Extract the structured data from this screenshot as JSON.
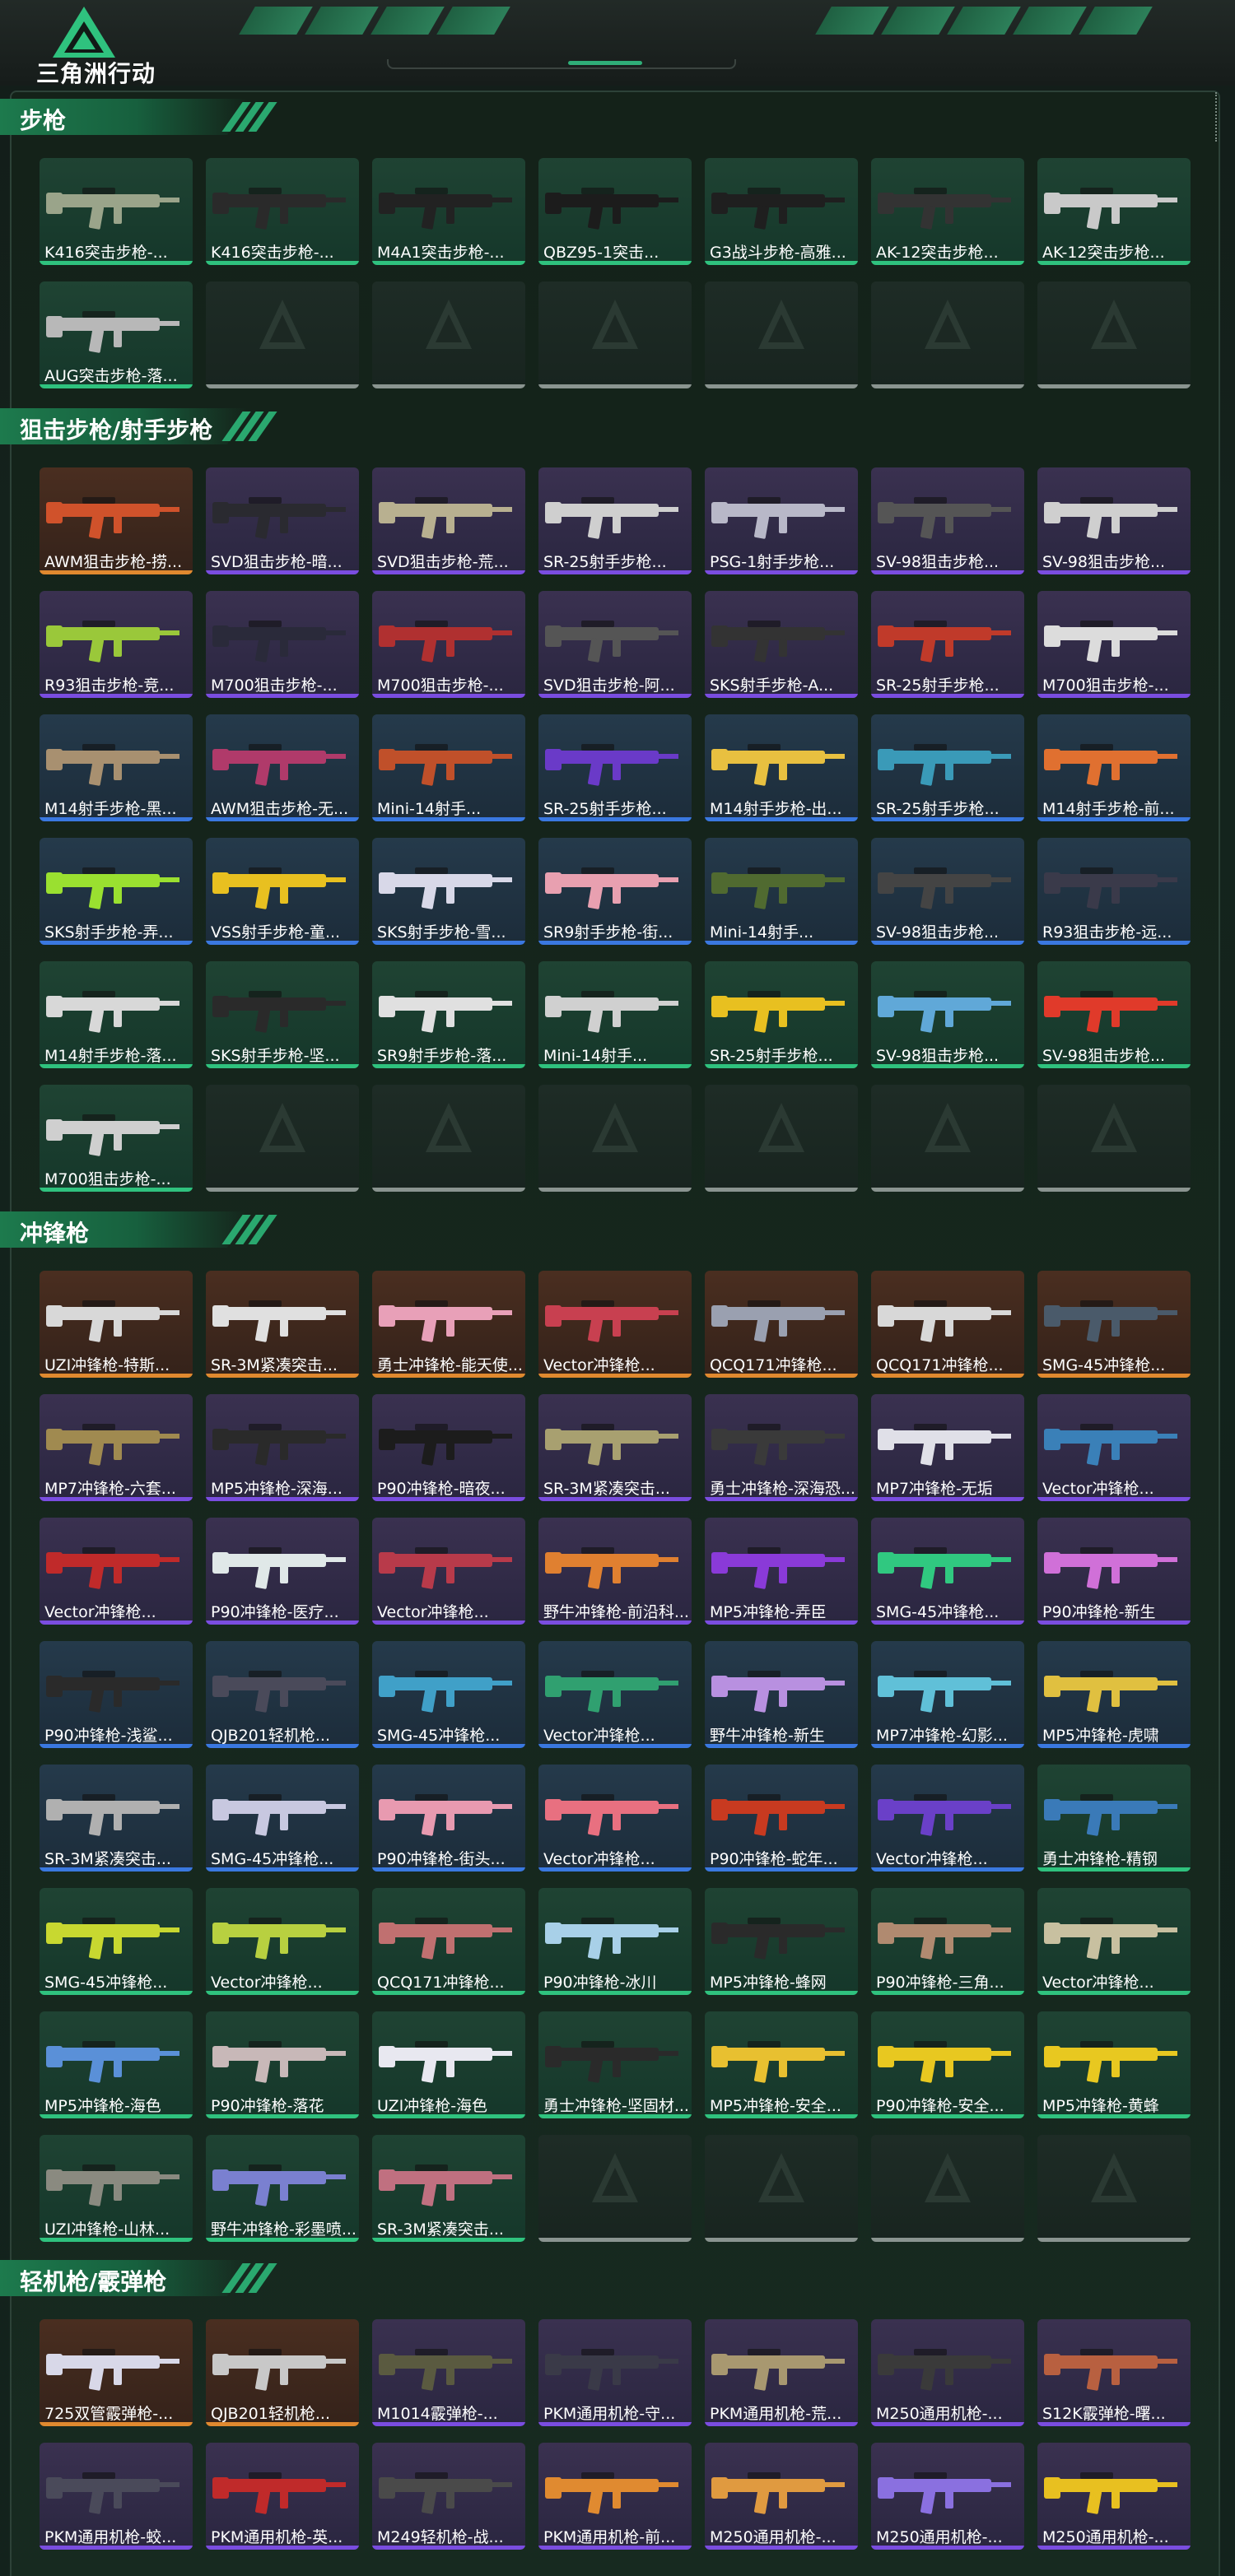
{
  "app": {
    "title": "三角洲行动"
  },
  "colors": {
    "purple": "#7a4de0",
    "green": "#2fc27e",
    "blue": "#3a78e0",
    "orange": "#e0892f",
    "empty": "#8a9490"
  },
  "sections": [
    {
      "title": "步枪",
      "rows": [
        [
          {
            "label": "K416突击步枪-...",
            "rarity": "green",
            "gun": "#9aa48a"
          },
          {
            "label": "K416突击步枪-...",
            "rarity": "green",
            "gun": "#2a2a2a"
          },
          {
            "label": "M4A1突击步枪-...",
            "rarity": "green",
            "gun": "#222"
          },
          {
            "label": "QBZ95-1突击...",
            "rarity": "green",
            "gun": "#1c1c1c"
          },
          {
            "label": "G3战斗步枪-高雅...",
            "rarity": "green",
            "gun": "#1f1f1f"
          },
          {
            "label": "AK-12突击步枪...",
            "rarity": "green",
            "gun": "#333"
          },
          {
            "label": "AK-12突击步枪...",
            "rarity": "green",
            "gun": "#c9c9c9"
          }
        ],
        [
          {
            "label": "AUG突击步枪-落...",
            "rarity": "green",
            "gun": "#b8b8b8"
          },
          {
            "empty": true
          },
          {
            "empty": true
          },
          {
            "empty": true
          },
          {
            "empty": true
          },
          {
            "empty": true
          },
          {
            "empty": true
          }
        ]
      ]
    },
    {
      "title": "狙击步枪/射手步枪",
      "rows": [
        [
          {
            "label": "AWM狙击步枪-捞...",
            "rarity": "orange",
            "gun": "#d0522b"
          },
          {
            "label": "SVD狙击步枪-暗...",
            "rarity": "purple",
            "gun": "#2a2a30"
          },
          {
            "label": "SVD狙击步枪-荒...",
            "rarity": "purple",
            "gun": "#b8b090"
          },
          {
            "label": "SR-25射手步枪...",
            "rarity": "purple",
            "gun": "#cfcfcf"
          },
          {
            "label": "PSG-1射手步枪...",
            "rarity": "purple",
            "gun": "#b8b8c8"
          },
          {
            "label": "SV-98狙击步枪...",
            "rarity": "purple",
            "gun": "#555"
          },
          {
            "label": "SV-98狙击步枪...",
            "rarity": "purple",
            "gun": "#cfcfcf"
          }
        ],
        [
          {
            "label": "R93狙击步枪-竞...",
            "rarity": "purple",
            "gun": "#9ac83a"
          },
          {
            "label": "M700狙击步枪-...",
            "rarity": "purple",
            "gun": "#2a2a3a"
          },
          {
            "label": "M700狙击步枪-...",
            "rarity": "purple",
            "gun": "#b03030"
          },
          {
            "label": "SVD狙击步枪-阿...",
            "rarity": "purple",
            "gun": "#555"
          },
          {
            "label": "SKS射手步枪-A...",
            "rarity": "purple",
            "gun": "#333"
          },
          {
            "label": "SR-25射手步枪...",
            "rarity": "purple",
            "gun": "#c03a2a"
          },
          {
            "label": "M700狙击步枪-...",
            "rarity": "purple",
            "gun": "#dcdcdc"
          }
        ],
        [
          {
            "label": "M14射手步枪-黑...",
            "rarity": "blue",
            "gun": "#a89070"
          },
          {
            "label": "AWM狙击步枪-无...",
            "rarity": "blue",
            "gun": "#b03a6a"
          },
          {
            "label": "Mini-14射手...",
            "rarity": "blue",
            "gun": "#c0502a"
          },
          {
            "label": "SR-25射手步枪...",
            "rarity": "blue",
            "gun": "#6a3ac8"
          },
          {
            "label": "M14射手步枪-出...",
            "rarity": "blue",
            "gun": "#e8c040"
          },
          {
            "label": "SR-25射手步枪...",
            "rarity": "blue",
            "gun": "#3a9ab8"
          },
          {
            "label": "M14射手步枪-前...",
            "rarity": "blue",
            "gun": "#e07030"
          }
        ],
        [
          {
            "label": "SKS射手步枪-弄...",
            "rarity": "blue",
            "gun": "#9ae030"
          },
          {
            "label": "VSS射手步枪-童...",
            "rarity": "blue",
            "gun": "#e8c020"
          },
          {
            "label": "SKS射手步枪-雪...",
            "rarity": "blue",
            "gun": "#d8d8e8"
          },
          {
            "label": "SR9射手步枪-街...",
            "rarity": "blue",
            "gun": "#e8a0b0"
          },
          {
            "label": "Mini-14射手...",
            "rarity": "blue",
            "gun": "#506a30"
          },
          {
            "label": "SV-98狙击步枪...",
            "rarity": "blue",
            "gun": "#444"
          },
          {
            "label": "R93狙击步枪-远...",
            "rarity": "blue",
            "gun": "#3a3a4a"
          }
        ],
        [
          {
            "label": "M14射手步枪-落...",
            "rarity": "green",
            "gun": "#d8d8d8"
          },
          {
            "label": "SKS射手步枪-坚...",
            "rarity": "green",
            "gun": "#2a2a2a"
          },
          {
            "label": "SR9射手步枪-落...",
            "rarity": "green",
            "gun": "#e0e0e0"
          },
          {
            "label": "Mini-14射手...",
            "rarity": "green",
            "gun": "#d0d0d0"
          },
          {
            "label": "SR-25射手步枪...",
            "rarity": "green",
            "gun": "#e8c020"
          },
          {
            "label": "SV-98狙击步枪...",
            "rarity": "green",
            "gun": "#60a8d8"
          },
          {
            "label": "SV-98狙击步枪...",
            "rarity": "green",
            "gun": "#e03a2a"
          }
        ],
        [
          {
            "label": "M700狙击步枪-...",
            "rarity": "green",
            "gun": "#cfcfcf"
          },
          {
            "empty": true
          },
          {
            "empty": true
          },
          {
            "empty": true
          },
          {
            "empty": true
          },
          {
            "empty": true
          },
          {
            "empty": true
          }
        ]
      ]
    },
    {
      "title": "冲锋枪",
      "rows": [
        [
          {
            "label": "UZI冲锋枪-特斯...",
            "rarity": "orange",
            "gun": "#d8d8d8"
          },
          {
            "label": "SR-3M紧凑突击...",
            "rarity": "orange",
            "gun": "#e0e0e0"
          },
          {
            "label": "勇士冲锋枪-能天使...",
            "rarity": "orange",
            "gun": "#e8a0b8"
          },
          {
            "label": "Vector冲锋枪...",
            "rarity": "orange",
            "gun": "#c84050"
          },
          {
            "label": "QCQ171冲锋枪...",
            "rarity": "orange",
            "gun": "#9aa0b0"
          },
          {
            "label": "QCQ171冲锋枪...",
            "rarity": "orange",
            "gun": "#d8d8d8"
          },
          {
            "label": "SMG-45冲锋枪...",
            "rarity": "orange",
            "gun": "#4a5a6a"
          }
        ],
        [
          {
            "label": "MP7冲锋枪-六套...",
            "rarity": "purple",
            "gun": "#a08a50"
          },
          {
            "label": "MP5冲锋枪-深海...",
            "rarity": "purple",
            "gun": "#2a2a2a"
          },
          {
            "label": "P90冲锋枪-暗夜...",
            "rarity": "purple",
            "gun": "#1c1c1c"
          },
          {
            "label": "SR-3M紧凑突击...",
            "rarity": "purple",
            "gun": "#a8a070"
          },
          {
            "label": "勇士冲锋枪-深海恐...",
            "rarity": "purple",
            "gun": "#3a3a3a"
          },
          {
            "label": "MP7冲锋枪-无垢",
            "rarity": "purple",
            "gun": "#e0e0e8"
          },
          {
            "label": "Vector冲锋枪...",
            "rarity": "purple",
            "gun": "#3a80b8"
          }
        ],
        [
          {
            "label": "Vector冲锋枪...",
            "rarity": "purple",
            "gun": "#c02a2a"
          },
          {
            "label": "P90冲锋枪-医疗...",
            "rarity": "purple",
            "gun": "#e0e8e8"
          },
          {
            "label": "Vector冲锋枪...",
            "rarity": "purple",
            "gun": "#b83a4a"
          },
          {
            "label": "野牛冲锋枪-前沿科...",
            "rarity": "purple",
            "gun": "#e08030"
          },
          {
            "label": "MP5冲锋枪-弄臣",
            "rarity": "purple",
            "gun": "#8a3ad8"
          },
          {
            "label": "SMG-45冲锋枪...",
            "rarity": "purple",
            "gun": "#30c880"
          },
          {
            "label": "P90冲锋枪-新生",
            "rarity": "purple",
            "gun": "#d070d8"
          }
        ],
        [
          {
            "label": "P90冲锋枪-浅鲨...",
            "rarity": "blue",
            "gun": "#2a2a2a"
          },
          {
            "label": "QJB201轻机枪...",
            "rarity": "blue",
            "gun": "#4a4a5a"
          },
          {
            "label": "SMG-45冲锋枪...",
            "rarity": "blue",
            "gun": "#40a0c8"
          },
          {
            "label": "Vector冲锋枪...",
            "rarity": "blue",
            "gun": "#30a070"
          },
          {
            "label": "野牛冲锋枪-新生",
            "rarity": "blue",
            "gun": "#b890e0"
          },
          {
            "label": "MP7冲锋枪-幻影...",
            "rarity": "blue",
            "gun": "#60c0d8"
          },
          {
            "label": "MP5冲锋枪-虎啸",
            "rarity": "blue",
            "gun": "#e0c040"
          }
        ],
        [
          {
            "label": "SR-3M紧凑突击...",
            "rarity": "blue",
            "gun": "#b0b0b0"
          },
          {
            "label": "SMG-45冲锋枪...",
            "rarity": "blue",
            "gun": "#c8c8e0"
          },
          {
            "label": "P90冲锋枪-街头...",
            "rarity": "blue",
            "gun": "#e89ab0"
          },
          {
            "label": "Vector冲锋枪...",
            "rarity": "blue",
            "gun": "#e87080"
          },
          {
            "label": "P90冲锋枪-蛇年...",
            "rarity": "blue",
            "gun": "#c83a20"
          },
          {
            "label": "Vector冲锋枪...",
            "rarity": "blue",
            "gun": "#6a40c8"
          },
          {
            "label": "勇士冲锋枪-精钢",
            "rarity": "green",
            "gun": "#3a7ab8"
          }
        ],
        [
          {
            "label": "SMG-45冲锋枪...",
            "rarity": "green",
            "gun": "#c8d830"
          },
          {
            "label": "Vector冲锋枪...",
            "rarity": "green",
            "gun": "#b8d040"
          },
          {
            "label": "QCQ171冲锋枪...",
            "rarity": "green",
            "gun": "#c07070"
          },
          {
            "label": "P90冲锋枪-冰川",
            "rarity": "green",
            "gun": "#a8d0e8"
          },
          {
            "label": "MP5冲锋枪-蜂网",
            "rarity": "green",
            "gun": "#2a2a2a"
          },
          {
            "label": "P90冲锋枪-三角...",
            "rarity": "green",
            "gun": "#b08a70"
          },
          {
            "label": "Vector冲锋枪...",
            "rarity": "green",
            "gun": "#c8c0a0"
          }
        ],
        [
          {
            "label": "MP5冲锋枪-海色",
            "rarity": "green",
            "gun": "#5a90d8"
          },
          {
            "label": "P90冲锋枪-落花",
            "rarity": "green",
            "gun": "#c8b8b8"
          },
          {
            "label": "UZI冲锋枪-海色",
            "rarity": "green",
            "gun": "#e8e8f0"
          },
          {
            "label": "勇士冲锋枪-坚固材...",
            "rarity": "green",
            "gun": "#2a2a2a"
          },
          {
            "label": "MP5冲锋枪-安全...",
            "rarity": "green",
            "gun": "#e8c030"
          },
          {
            "label": "P90冲锋枪-安全...",
            "rarity": "green",
            "gun": "#e8c820"
          },
          {
            "label": "MP5冲锋枪-黄蜂",
            "rarity": "green",
            "gun": "#e8c820"
          }
        ],
        [
          {
            "label": "UZI冲锋枪-山林...",
            "rarity": "green",
            "gun": "#8a8a80"
          },
          {
            "label": "野牛冲锋枪-彩墨喷...",
            "rarity": "green",
            "gun": "#7a80d0"
          },
          {
            "label": "SR-3M紧凑突击...",
            "rarity": "green",
            "gun": "#c07080"
          },
          {
            "empty": true
          },
          {
            "empty": true
          },
          {
            "empty": true
          },
          {
            "empty": true
          }
        ]
      ]
    },
    {
      "title": "轻机枪/霰弹枪",
      "rows": [
        [
          {
            "label": "725双管霰弹枪-...",
            "rarity": "orange",
            "gun": "#d8d8e8"
          },
          {
            "label": "QJB201轻机枪...",
            "rarity": "orange",
            "gun": "#c8c8c8"
          },
          {
            "label": "M1014霰弹枪-...",
            "rarity": "purple",
            "gun": "#5a5a40"
          },
          {
            "label": "PKM通用机枪-守...",
            "rarity": "purple",
            "gun": "#3a3a48"
          },
          {
            "label": "PKM通用机枪-荒...",
            "rarity": "purple",
            "gun": "#a89870"
          },
          {
            "label": "M250通用机枪-...",
            "rarity": "purple",
            "gun": "#3a3a3a"
          },
          {
            "label": "S12K霰弹枪-曙...",
            "rarity": "purple",
            "gun": "#b86040"
          }
        ],
        [
          {
            "label": "PKM通用机枪-蛟...",
            "rarity": "purple",
            "gun": "#4a4a5a"
          },
          {
            "label": "PKM通用机枪-英...",
            "rarity": "purple",
            "gun": "#c02a2a"
          },
          {
            "label": "M249轻机枪-战...",
            "rarity": "purple",
            "gun": "#4a4a4a"
          },
          {
            "label": "PKM通用机枪-前...",
            "rarity": "purple",
            "gun": "#e08a30"
          },
          {
            "label": "M250通用机枪-...",
            "rarity": "purple",
            "gun": "#e09a40"
          },
          {
            "label": "M250通用机枪-...",
            "rarity": "purple",
            "gun": "#8a70e0"
          },
          {
            "label": "M250通用机枪-...",
            "rarity": "purple",
            "gun": "#e8c020"
          }
        ]
      ]
    }
  ]
}
